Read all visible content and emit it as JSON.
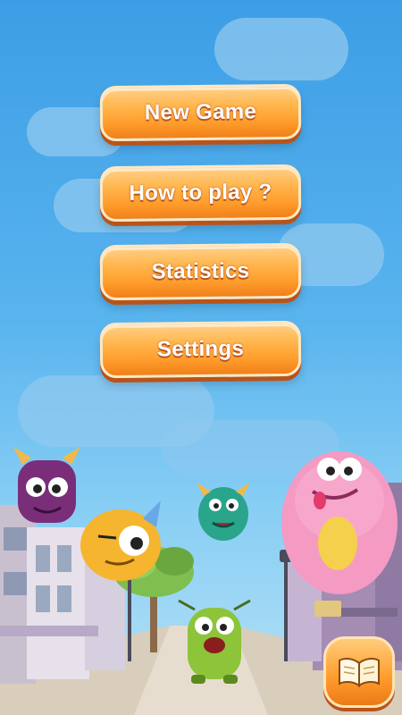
{
  "menu": {
    "new_game": "New Game",
    "how_to_play": "How to play ?",
    "statistics": "Statistics",
    "settings": "Settings"
  },
  "icons": {
    "book": "open-book-icon"
  },
  "colors": {
    "sky_top": "#3d9ee6",
    "button_orange": "#ff9d2c",
    "button_shadow": "#b8541a",
    "text": "#ffffff"
  }
}
